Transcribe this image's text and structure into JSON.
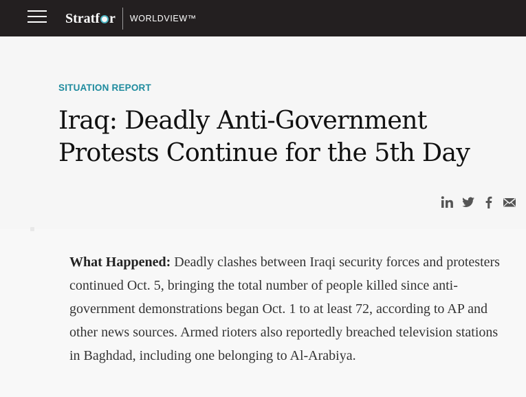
{
  "nav": {
    "menu_label": "",
    "brand_part1": "Stratf",
    "brand_part2": "r",
    "brand_sub": "WORLDVIEW™"
  },
  "article": {
    "kicker": "SITUATION REPORT",
    "title": "Iraq: Deadly Anti-Government Protests Continue for the 5th Day",
    "lead_label": "What Happened:",
    "lead_text": " Deadly clashes between Iraqi security forces and protesters continued Oct. 5, bringing the total number of people killed since anti-government demonstrations began Oct. 1 to at least 72, according to AP and other news sources. Armed rioters also reportedly breached television stations in Baghdad, including one belonging to Al-Arabiya."
  },
  "share_icons": [
    "linkedin-icon",
    "twitter-icon",
    "facebook-icon",
    "email-icon"
  ],
  "colors": {
    "topbar": "#231f20",
    "accent": "#1e8b9e",
    "background": "#f8f8f8"
  }
}
